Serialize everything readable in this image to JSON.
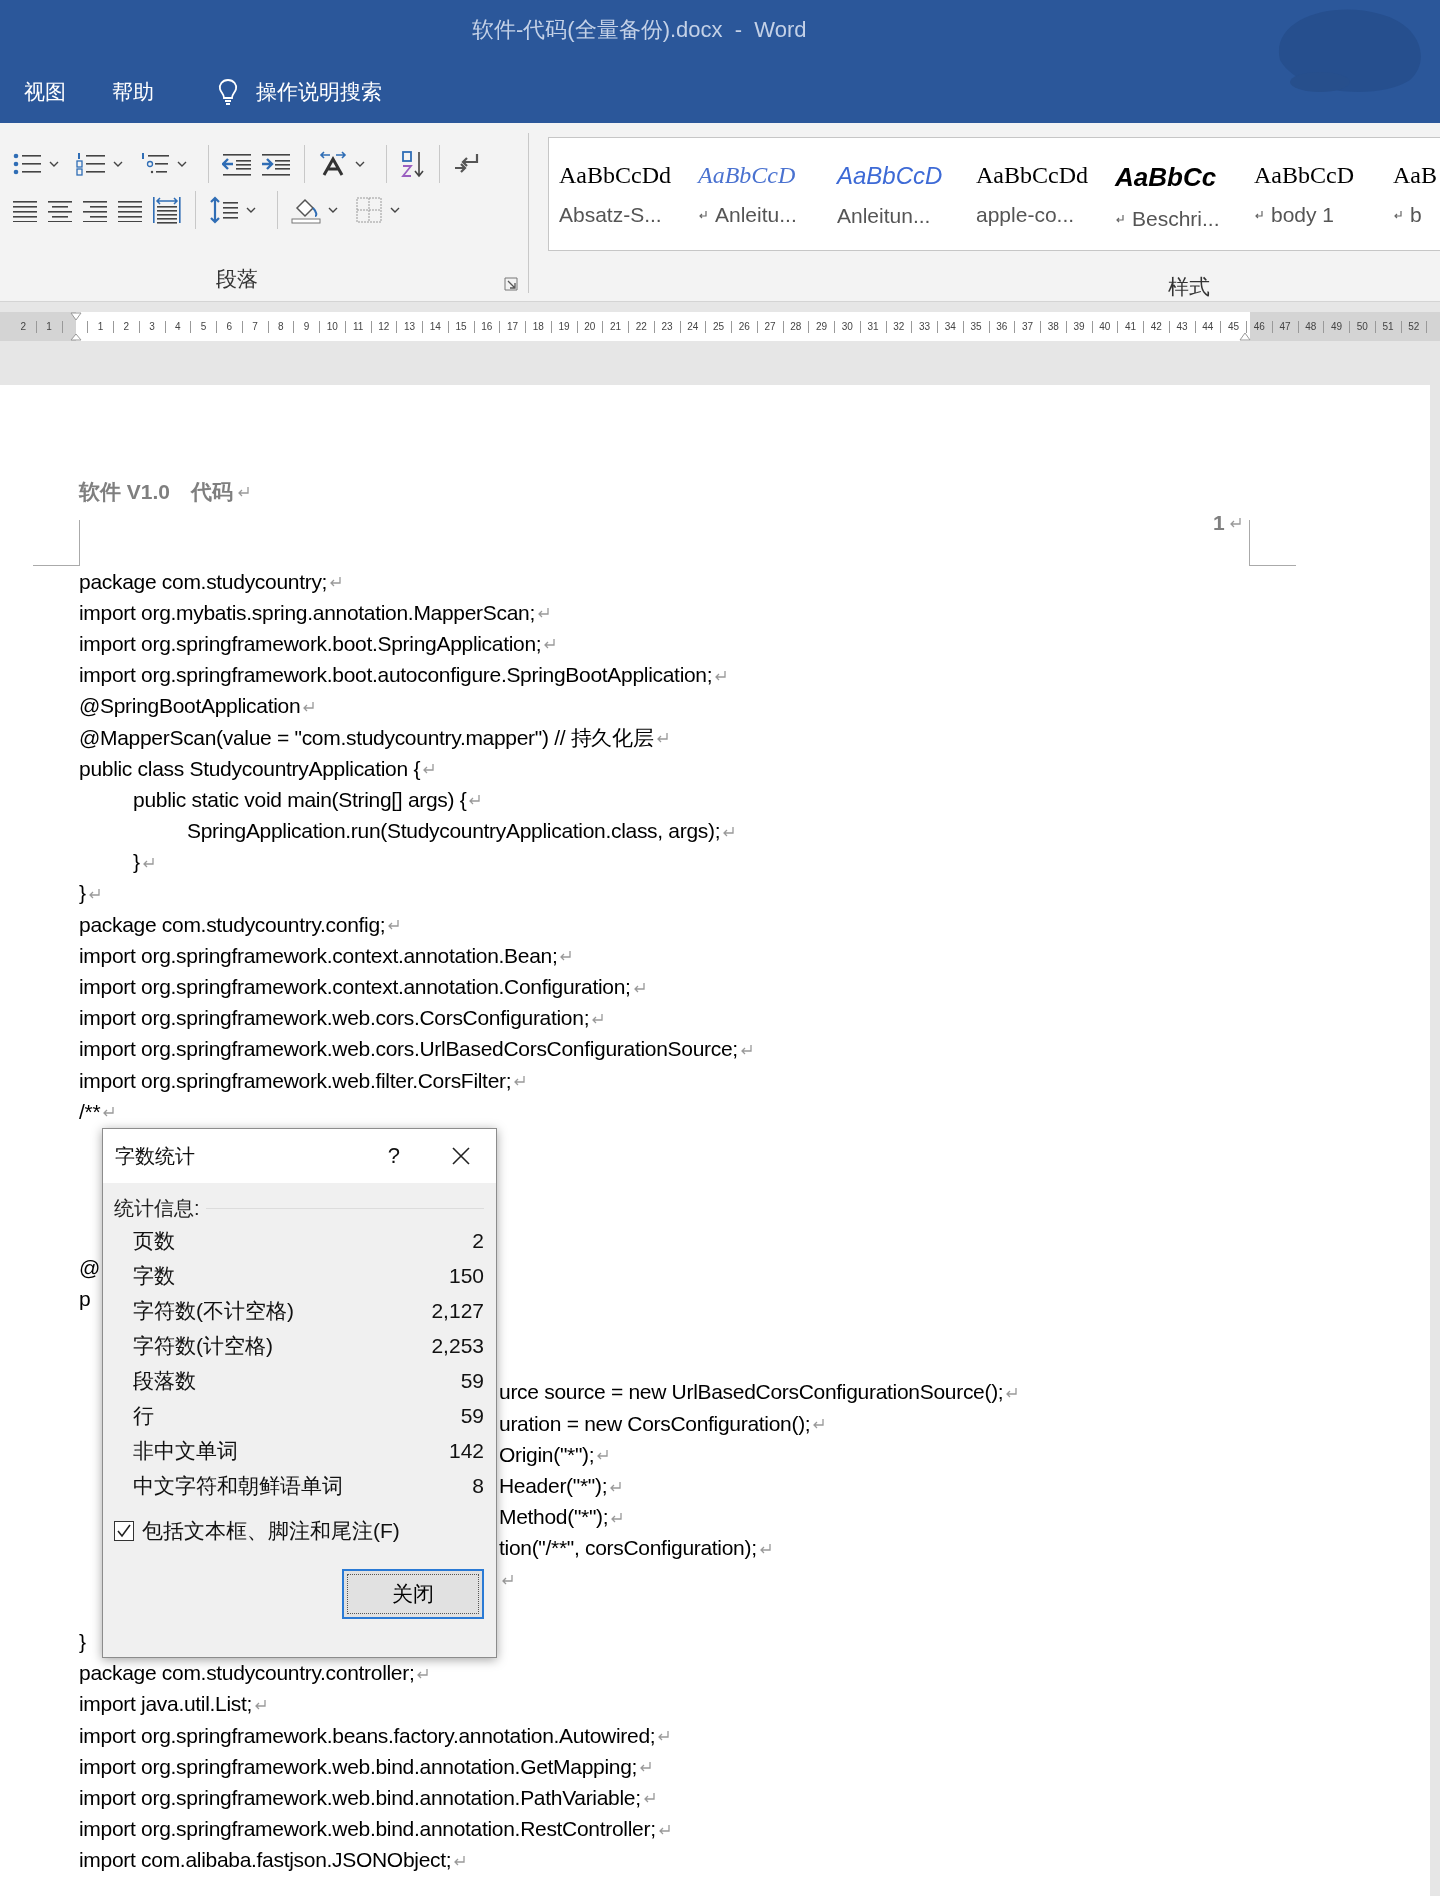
{
  "window": {
    "title": "软件-代码(全量备份).docx  -  Word"
  },
  "menu": [
    {
      "label": "视图"
    },
    {
      "label": "帮助"
    }
  ],
  "tell_me": {
    "placeholder": "操作说明搜索"
  },
  "ribbon": {
    "groups": [
      {
        "label": "段落"
      },
      {
        "label": "样式"
      }
    ],
    "styles": [
      {
        "preview": "AaBbCcDd",
        "name": "Absatz-S...",
        "kind": "plain",
        "paragraph_style": false
      },
      {
        "preview": "AaBbCcD",
        "name": "Anleitu...",
        "kind": "italic",
        "paragraph_style": true
      },
      {
        "preview": "AaBbCcD",
        "name": "Anleitun...",
        "kind": "accent",
        "paragraph_style": false
      },
      {
        "preview": "AaBbCcDd",
        "name": "apple-co...",
        "kind": "plain",
        "paragraph_style": false
      },
      {
        "preview": "AaBbCc",
        "name": "Beschri...",
        "kind": "strong",
        "paragraph_style": true
      },
      {
        "preview": "AaBbCcD",
        "name": "body 1",
        "kind": "plain",
        "paragraph_style": true
      },
      {
        "preview": "AaB",
        "name": "b",
        "kind": "plain",
        "paragraph_style": true
      }
    ]
  },
  "ruler": {
    "left_numbers": [
      "2",
      "1"
    ],
    "numbers": [
      "1",
      "2",
      "3",
      "4",
      "5",
      "6",
      "7",
      "8",
      "9",
      "10",
      "11",
      "12",
      "13",
      "14",
      "15",
      "16",
      "17",
      "18",
      "19",
      "20",
      "21",
      "22",
      "23",
      "24",
      "25",
      "26",
      "27",
      "28",
      "29",
      "30",
      "31",
      "32",
      "33",
      "34",
      "35",
      "36",
      "37",
      "38",
      "39",
      "40",
      "41",
      "42",
      "43",
      "44",
      "45"
    ],
    "right_numbers": [
      "46",
      "47",
      "48",
      "49",
      "50",
      "51",
      "52"
    ]
  },
  "document": {
    "header": {
      "text": "软件 V1.0　代码",
      "paragraph_mark": true
    },
    "page_number": {
      "text": "1",
      "paragraph_mark": true
    },
    "lines": [
      {
        "kind": "full",
        "text": "package com.studycountry;",
        "paragraph_mark": true
      },
      {
        "kind": "full",
        "text": "import org.mybatis.spring.annotation.MapperScan;",
        "paragraph_mark": true
      },
      {
        "kind": "full",
        "text": "import org.springframework.boot.SpringApplication;",
        "paragraph_mark": true
      },
      {
        "kind": "full",
        "text": "import org.springframework.boot.autoconfigure.SpringBootApplication;",
        "paragraph_mark": true
      },
      {
        "kind": "full",
        "text": "@SpringBootApplication",
        "paragraph_mark": true
      },
      {
        "kind": "full",
        "text": "@MapperScan(value = \"com.studycountry.mapper\") // 持久化层",
        "paragraph_mark": true
      },
      {
        "kind": "full",
        "text": "public class StudycountryApplication {",
        "paragraph_mark": true
      },
      {
        "kind": "full",
        "text": "\tpublic static void main(String[] args) {",
        "paragraph_mark": true
      },
      {
        "kind": "full",
        "text": "\t\tSpringApplication.run(StudycountryApplication.class, args);",
        "paragraph_mark": true
      },
      {
        "kind": "full",
        "text": "\t}",
        "paragraph_mark": true
      },
      {
        "kind": "full",
        "text": "}",
        "paragraph_mark": true
      },
      {
        "kind": "full",
        "text": "package com.studycountry.config;",
        "paragraph_mark": true
      },
      {
        "kind": "full",
        "text": "import org.springframework.context.annotation.Bean;",
        "paragraph_mark": true
      },
      {
        "kind": "full",
        "text": "import org.springframework.context.annotation.Configuration;",
        "paragraph_mark": true
      },
      {
        "kind": "full",
        "text": "import org.springframework.web.cors.CorsConfiguration;",
        "paragraph_mark": true
      },
      {
        "kind": "full",
        "text": "import org.springframework.web.cors.UrlBasedCorsConfigurationSource;",
        "paragraph_mark": true
      },
      {
        "kind": "full",
        "text": "import org.springframework.web.filter.CorsFilter;",
        "paragraph_mark": true
      },
      {
        "kind": "full",
        "text": "/**",
        "paragraph_mark": true
      },
      {
        "kind": "covered"
      },
      {
        "kind": "covered"
      },
      {
        "kind": "covered"
      },
      {
        "kind": "covered"
      },
      {
        "kind": "full",
        "text": "@",
        "paragraph_mark": false
      },
      {
        "kind": "full",
        "text": "p",
        "paragraph_mark": false
      },
      {
        "kind": "covered"
      },
      {
        "kind": "covered"
      },
      {
        "kind": "tail",
        "text": "urce source = new UrlBasedCorsConfigurationSource();",
        "paragraph_mark": true
      },
      {
        "kind": "tail",
        "text": "uration = new CorsConfiguration();",
        "paragraph_mark": true
      },
      {
        "kind": "tail",
        "text": "Origin(\"*\");",
        "paragraph_mark": true
      },
      {
        "kind": "tail",
        "text": "Header(\"*\");",
        "paragraph_mark": true
      },
      {
        "kind": "tail",
        "text": "Method(\"*\");",
        "paragraph_mark": true
      },
      {
        "kind": "tail",
        "text": "tion(\"/**\", corsConfiguration);",
        "paragraph_mark": true
      },
      {
        "kind": "tail",
        "paragraph_mark": true
      },
      {
        "kind": "covered"
      },
      {
        "kind": "full",
        "text": "}",
        "paragraph_mark": false
      },
      {
        "kind": "full",
        "text": "package com.studycountry.controller;",
        "paragraph_mark": true
      },
      {
        "kind": "full",
        "text": "import java.util.List;",
        "paragraph_mark": true
      },
      {
        "kind": "full",
        "text": "import org.springframework.beans.factory.annotation.Autowired;",
        "paragraph_mark": true
      },
      {
        "kind": "full",
        "text": "import org.springframework.web.bind.annotation.GetMapping;",
        "paragraph_mark": true
      },
      {
        "kind": "full",
        "text": "import org.springframework.web.bind.annotation.PathVariable;",
        "paragraph_mark": true
      },
      {
        "kind": "full",
        "text": "import org.springframework.web.bind.annotation.RestController;",
        "paragraph_mark": true
      },
      {
        "kind": "full",
        "text": "import com.alibaba.fastjson.JSONObject;",
        "paragraph_mark": true
      }
    ]
  },
  "dialog": {
    "title": "字数统计",
    "help": "?",
    "section": "统计信息:",
    "stats": [
      {
        "label": "页数",
        "value": "2"
      },
      {
        "label": "字数",
        "value": "150"
      },
      {
        "label": "字符数(不计空格)",
        "value": "2,127"
      },
      {
        "label": "字符数(计空格)",
        "value": "2,253"
      },
      {
        "label": "段落数",
        "value": "59"
      },
      {
        "label": "行",
        "value": "59"
      },
      {
        "label": "非中文单词",
        "value": "142"
      },
      {
        "label": "中文字符和朝鲜语单词",
        "value": "8"
      }
    ],
    "checkbox": {
      "label": "包括文本框、脚注和尾注(F)",
      "checked": true
    },
    "buttons": [
      {
        "label": "关闭",
        "default": true
      }
    ]
  }
}
